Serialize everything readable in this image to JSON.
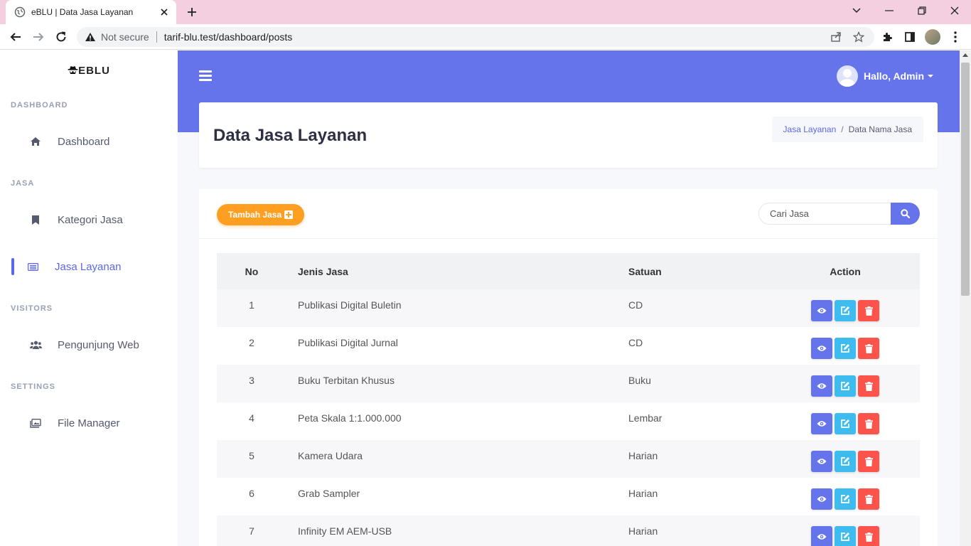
{
  "browser": {
    "tab_title": "eBLU | Data Jasa Layanan",
    "security_label": "Not secure",
    "url": "tarif-blu.test/dashboard/posts"
  },
  "sidebar": {
    "brand": "EBLU",
    "sections": [
      {
        "heading": "DASHBOARD",
        "items": [
          {
            "label": "Dashboard",
            "icon": "home-icon",
            "active": false
          }
        ]
      },
      {
        "heading": "JASA",
        "items": [
          {
            "label": "Kategori Jasa",
            "icon": "bookmark-icon",
            "active": false
          },
          {
            "label": "Jasa Layanan",
            "icon": "list-icon",
            "active": true
          }
        ]
      },
      {
        "heading": "VISITORS",
        "items": [
          {
            "label": "Pengunjung Web",
            "icon": "users-icon",
            "active": false
          }
        ]
      },
      {
        "heading": "SETTINGS",
        "items": [
          {
            "label": "File Manager",
            "icon": "images-icon",
            "active": false
          }
        ]
      }
    ]
  },
  "header": {
    "user_greeting": "Hallo, Admin"
  },
  "page": {
    "title": "Data Jasa Layanan",
    "breadcrumb": {
      "link": "Jasa Layanan",
      "current": "Data Nama Jasa"
    },
    "add_button": "Tambah Jasa",
    "search_placeholder": "Cari Jasa"
  },
  "table": {
    "headers": {
      "no": "No",
      "jenis": "Jenis Jasa",
      "satuan": "Satuan",
      "action": "Action"
    },
    "rows": [
      {
        "no": "1",
        "jenis": "Publikasi Digital Buletin",
        "satuan": "CD"
      },
      {
        "no": "2",
        "jenis": "Publikasi Digital Jurnal",
        "satuan": "CD"
      },
      {
        "no": "3",
        "jenis": "Buku Terbitan Khusus",
        "satuan": "Buku"
      },
      {
        "no": "4",
        "jenis": "Peta Skala 1:1.000.000",
        "satuan": "Lembar"
      },
      {
        "no": "5",
        "jenis": "Kamera Udara",
        "satuan": "Harian"
      },
      {
        "no": "6",
        "jenis": "Grab Sampler",
        "satuan": "Harian"
      },
      {
        "no": "7",
        "jenis": "Infinity EM AEM-USB",
        "satuan": "Harian"
      }
    ]
  },
  "colors": {
    "primary": "#6674ec",
    "warning": "#ff9f22",
    "info": "#3ebcf0",
    "danger": "#fc544b",
    "tabbar": "#f4cfe0"
  }
}
